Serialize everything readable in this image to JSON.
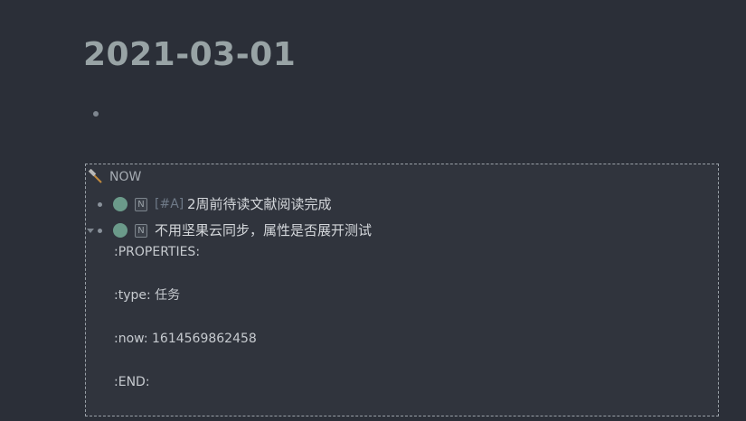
{
  "page": {
    "title": "2021-03-01"
  },
  "query": {
    "title": "NOW",
    "header_icon": "hammer-icon",
    "items": [
      {
        "marker": "N",
        "priority": "[#A]",
        "text": "2周前待读文献阅读完成"
      },
      {
        "marker": "N",
        "text": "不用坚果云同步，属性是否展开测试",
        "properties": [
          ":PROPERTIES:",
          ":type: 任务",
          ":now: 1614569862458",
          ":END:"
        ]
      }
    ]
  },
  "colors": {
    "background": "#2b2f38",
    "marker_dot": "#6b9a8a",
    "title": "#98a3a5"
  }
}
